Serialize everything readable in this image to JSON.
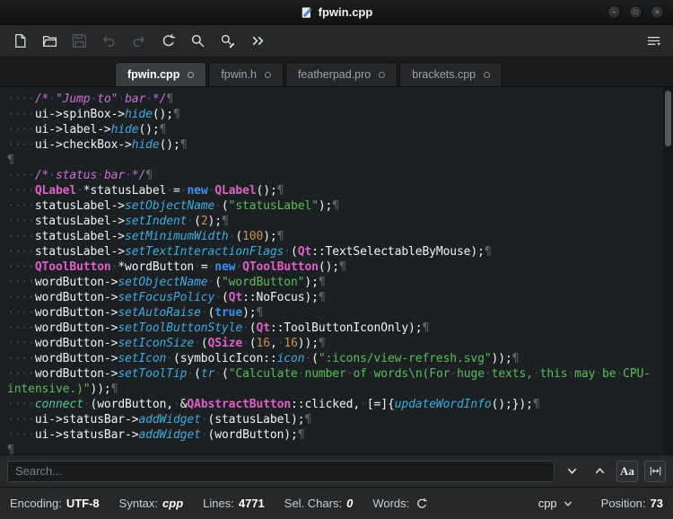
{
  "window": {
    "title": "fpwin.cpp",
    "controls": [
      {
        "name": "minimize-button",
        "glyph": "−"
      },
      {
        "name": "maximize-button",
        "glyph": "□"
      },
      {
        "name": "close-button",
        "glyph": "×"
      }
    ]
  },
  "toolbar": {
    "buttons": [
      {
        "icon": "new-document-icon",
        "enabled": true
      },
      {
        "icon": "open-file-icon",
        "enabled": true
      },
      {
        "icon": "save-icon",
        "enabled": false
      },
      {
        "icon": "undo-icon",
        "enabled": false
      },
      {
        "icon": "redo-icon",
        "enabled": false
      },
      {
        "icon": "reload-icon",
        "enabled": true
      },
      {
        "icon": "search-icon",
        "enabled": true
      },
      {
        "icon": "find-replace-icon",
        "enabled": true
      },
      {
        "icon": "more-toolbuttons-icon",
        "enabled": true
      }
    ],
    "menu_icon": "menu-icon"
  },
  "tabs": [
    {
      "label": "fpwin.cpp",
      "active": true
    },
    {
      "label": "fpwin.h",
      "active": false
    },
    {
      "label": "featherpad.pro",
      "active": false
    },
    {
      "label": "brackets.cpp",
      "active": false
    }
  ],
  "editor": {
    "colors": {
      "tok-p": "#f2f2f2",
      "tok-c": "#ca70d6",
      "tok-f": "#3dabdf",
      "tok-q": "#4fc98f",
      "tok-k": "#3c8ef5",
      "tok-t": "#de5fc8",
      "tok-s": "#5abd57",
      "tok-n": "#c6904f",
      "tok-ws": "#4a4f55",
      "pilcrow": "#5f646a"
    },
    "lines": [
      {
        "eol": true,
        "tokens": [
          [
            "p",
            "    "
          ],
          [
            "c",
            "/* \"Jump to\" bar */"
          ]
        ]
      },
      {
        "eol": true,
        "tokens": [
          [
            "p",
            "    ui->spinBox->"
          ],
          [
            "f",
            "hide"
          ],
          [
            "p",
            "();"
          ]
        ]
      },
      {
        "eol": true,
        "tokens": [
          [
            "p",
            "    ui->label->"
          ],
          [
            "f",
            "hide"
          ],
          [
            "p",
            "();"
          ]
        ]
      },
      {
        "eol": true,
        "tokens": [
          [
            "p",
            "    ui->checkBox->"
          ],
          [
            "f",
            "hide"
          ],
          [
            "p",
            "();"
          ]
        ]
      },
      {
        "eol": true,
        "tokens": []
      },
      {
        "eol": true,
        "tokens": [
          [
            "p",
            "    "
          ],
          [
            "c",
            "/* status bar */"
          ]
        ]
      },
      {
        "eol": true,
        "tokens": [
          [
            "p",
            "    "
          ],
          [
            "t",
            "QLabel"
          ],
          [
            "p",
            " *statusLabel = "
          ],
          [
            "k",
            "new"
          ],
          [
            "p",
            " "
          ],
          [
            "t",
            "QLabel"
          ],
          [
            "p",
            "();"
          ]
        ]
      },
      {
        "eol": true,
        "tokens": [
          [
            "p",
            "    statusLabel->"
          ],
          [
            "f",
            "setObjectName"
          ],
          [
            "p",
            " ("
          ],
          [
            "s",
            "\"statusLabel\""
          ],
          [
            "p",
            ");"
          ]
        ]
      },
      {
        "eol": true,
        "tokens": [
          [
            "p",
            "    statusLabel->"
          ],
          [
            "f",
            "setIndent"
          ],
          [
            "p",
            " ("
          ],
          [
            "n",
            "2"
          ],
          [
            "p",
            ");"
          ]
        ]
      },
      {
        "eol": true,
        "tokens": [
          [
            "p",
            "    statusLabel->"
          ],
          [
            "f",
            "setMinimumWidth"
          ],
          [
            "p",
            " ("
          ],
          [
            "n",
            "100"
          ],
          [
            "p",
            ");"
          ]
        ]
      },
      {
        "eol": true,
        "tokens": [
          [
            "p",
            "    statusLabel->"
          ],
          [
            "f",
            "setTextInteractionFlags"
          ],
          [
            "p",
            " ("
          ],
          [
            "t",
            "Qt"
          ],
          [
            "p",
            "::TextSelectableByMouse);"
          ]
        ]
      },
      {
        "eol": true,
        "tokens": [
          [
            "p",
            "    "
          ],
          [
            "t",
            "QToolButton"
          ],
          [
            "p",
            " *wordButton = "
          ],
          [
            "k",
            "new"
          ],
          [
            "p",
            " "
          ],
          [
            "t",
            "QToolButton"
          ],
          [
            "p",
            "();"
          ]
        ]
      },
      {
        "eol": true,
        "tokens": [
          [
            "p",
            "    wordButton->"
          ],
          [
            "f",
            "setObjectName"
          ],
          [
            "p",
            " ("
          ],
          [
            "s",
            "\"wordButton\""
          ],
          [
            "p",
            ");"
          ]
        ]
      },
      {
        "eol": true,
        "tokens": [
          [
            "p",
            "    wordButton->"
          ],
          [
            "f",
            "setFocusPolicy"
          ],
          [
            "p",
            " ("
          ],
          [
            "t",
            "Qt"
          ],
          [
            "p",
            "::NoFocus);"
          ]
        ]
      },
      {
        "eol": true,
        "tokens": [
          [
            "p",
            "    wordButton->"
          ],
          [
            "f",
            "setAutoRaise"
          ],
          [
            "p",
            " ("
          ],
          [
            "k",
            "true"
          ],
          [
            "p",
            ");"
          ]
        ]
      },
      {
        "eol": true,
        "tokens": [
          [
            "p",
            "    wordButton->"
          ],
          [
            "f",
            "setToolButtonStyle"
          ],
          [
            "p",
            " ("
          ],
          [
            "t",
            "Qt"
          ],
          [
            "p",
            "::ToolButtonIconOnly);"
          ]
        ]
      },
      {
        "eol": true,
        "tokens": [
          [
            "p",
            "    wordButton->"
          ],
          [
            "f",
            "setIconSize"
          ],
          [
            "p",
            " ("
          ],
          [
            "t",
            "QSize"
          ],
          [
            "p",
            " ("
          ],
          [
            "n",
            "16"
          ],
          [
            "p",
            ", "
          ],
          [
            "n",
            "16"
          ],
          [
            "p",
            "));"
          ]
        ]
      },
      {
        "eol": true,
        "tokens": [
          [
            "p",
            "    wordButton->"
          ],
          [
            "f",
            "setIcon"
          ],
          [
            "p",
            " (symbolicIcon::"
          ],
          [
            "f",
            "icon"
          ],
          [
            "p",
            " ("
          ],
          [
            "s",
            "\":icons/view-refresh.svg\""
          ],
          [
            "p",
            "));"
          ]
        ]
      },
      {
        "eol": false,
        "tokens": [
          [
            "p",
            "    wordButton->"
          ],
          [
            "f",
            "setToolTip"
          ],
          [
            "p",
            " ("
          ],
          [
            "f",
            "tr"
          ],
          [
            "p",
            " ("
          ],
          [
            "s",
            "\"Calculate number of words\\n(For huge texts, this may be CPU-"
          ]
        ]
      },
      {
        "eol": true,
        "tokens": [
          [
            "s",
            "intensive.)\""
          ],
          [
            "p",
            "));"
          ]
        ]
      },
      {
        "eol": true,
        "tokens": [
          [
            "p",
            "    "
          ],
          [
            "q",
            "connect"
          ],
          [
            "p",
            " (wordButton, &"
          ],
          [
            "t",
            "QAbstractButton"
          ],
          [
            "p",
            "::clicked, [=]{"
          ],
          [
            "f",
            "updateWordInfo"
          ],
          [
            "p",
            "();});"
          ]
        ]
      },
      {
        "eol": true,
        "tokens": [
          [
            "p",
            "    ui->statusBar->"
          ],
          [
            "f",
            "addWidget"
          ],
          [
            "p",
            " (statusLabel);"
          ]
        ]
      },
      {
        "eol": true,
        "tokens": [
          [
            "p",
            "    ui->statusBar->"
          ],
          [
            "f",
            "addWidget"
          ],
          [
            "p",
            " (wordButton);"
          ]
        ]
      },
      {
        "eol": true,
        "tokens": []
      }
    ]
  },
  "search": {
    "placeholder": "Search...",
    "value": "",
    "match_case_label": "Aa"
  },
  "statusbar": {
    "encoding_label": "Encoding:",
    "encoding_value": "UTF-8",
    "syntax_label": "Syntax:",
    "syntax_value": "cpp",
    "lines_label": "Lines:",
    "lines_value": "4771",
    "sel_chars_label": "Sel. Chars:",
    "sel_chars_value": "0",
    "words_label": "Words:",
    "syntax_combo_value": "cpp",
    "position_label": "Position:",
    "position_value": "73"
  }
}
